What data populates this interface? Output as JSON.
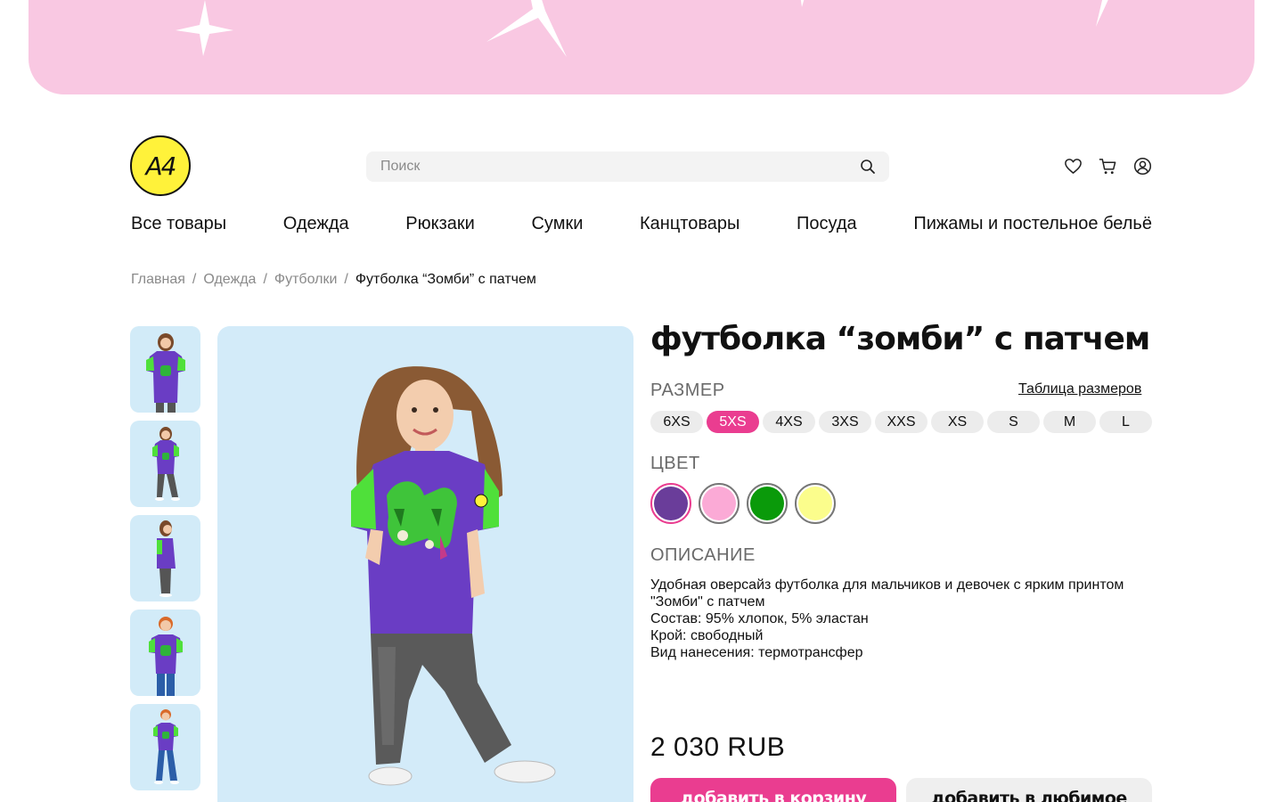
{
  "brand": {
    "logo_text": "A4"
  },
  "search": {
    "placeholder": "Поиск",
    "icon": "search-icon"
  },
  "header_icons": [
    "heart-icon",
    "cart-icon",
    "user-icon"
  ],
  "nav": [
    {
      "label": "Все товары"
    },
    {
      "label": "Одежда"
    },
    {
      "label": "Рюкзаки"
    },
    {
      "label": "Сумки"
    },
    {
      "label": "Канцтовары"
    },
    {
      "label": "Посуда"
    },
    {
      "label": "Пижамы и постельное бельё"
    }
  ],
  "breadcrumb": {
    "items": [
      "Главная",
      "Одежда",
      "Футболки"
    ],
    "separator": "/",
    "current": "Футболка “Зомби” с патчем"
  },
  "product": {
    "title": "футболка “зомби” с патчем",
    "size_label": "РАЗМЕР",
    "size_table_link": "Таблица размеров",
    "sizes": [
      "6XS",
      "5XS",
      "4XS",
      "3XS",
      "XXS",
      "XS",
      "S",
      "M",
      "L"
    ],
    "selected_size": "5XS",
    "color_label": "ЦВЕТ",
    "colors": [
      "#6a3d9a",
      "#fbaad6",
      "#0a9a0a",
      "#fbfd8c"
    ],
    "selected_color_index": 0,
    "description_label": "ОПИСАНИЕ",
    "description_lines": [
      "Удобная оверсайз футболка для мальчиков и девочек с ярким принтом \"Зомби\" с патчем",
      "Состав: 95% хлопок, 5% эластан",
      "Крой: свободный",
      "Вид нанесения: термотрансфер"
    ],
    "price": "2 030 RUB",
    "add_to_cart": "добавить в корзину",
    "add_to_favorites": "добавить в любимое"
  },
  "colors": {
    "accent": "#ea3d90",
    "banner": "#f9c8e2",
    "logo_bg": "#fff23a",
    "image_bg": "#d3ebf9"
  }
}
